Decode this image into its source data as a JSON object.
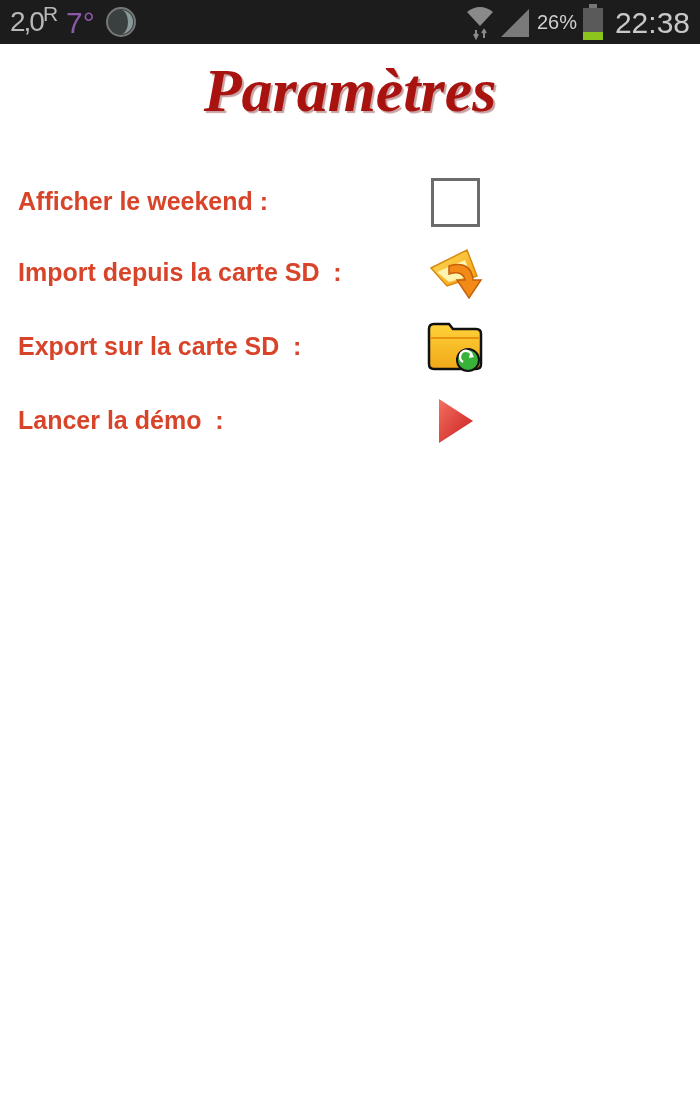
{
  "status_bar": {
    "temperature_reading": "2,0$^{R}$",
    "weather": "7°",
    "battery": "26%",
    "time": "22:38"
  },
  "title": "Paramètres",
  "settings": [
    {
      "kind": "checkbox",
      "label": "Afficher le weekend :",
      "checked": false
    },
    {
      "kind": "import",
      "label": "Import depuis la carte SD  :"
    },
    {
      "kind": "export",
      "label": "Export sur la carte SD  :"
    },
    {
      "kind": "play",
      "label": "Lancer la démo  :"
    }
  ]
}
